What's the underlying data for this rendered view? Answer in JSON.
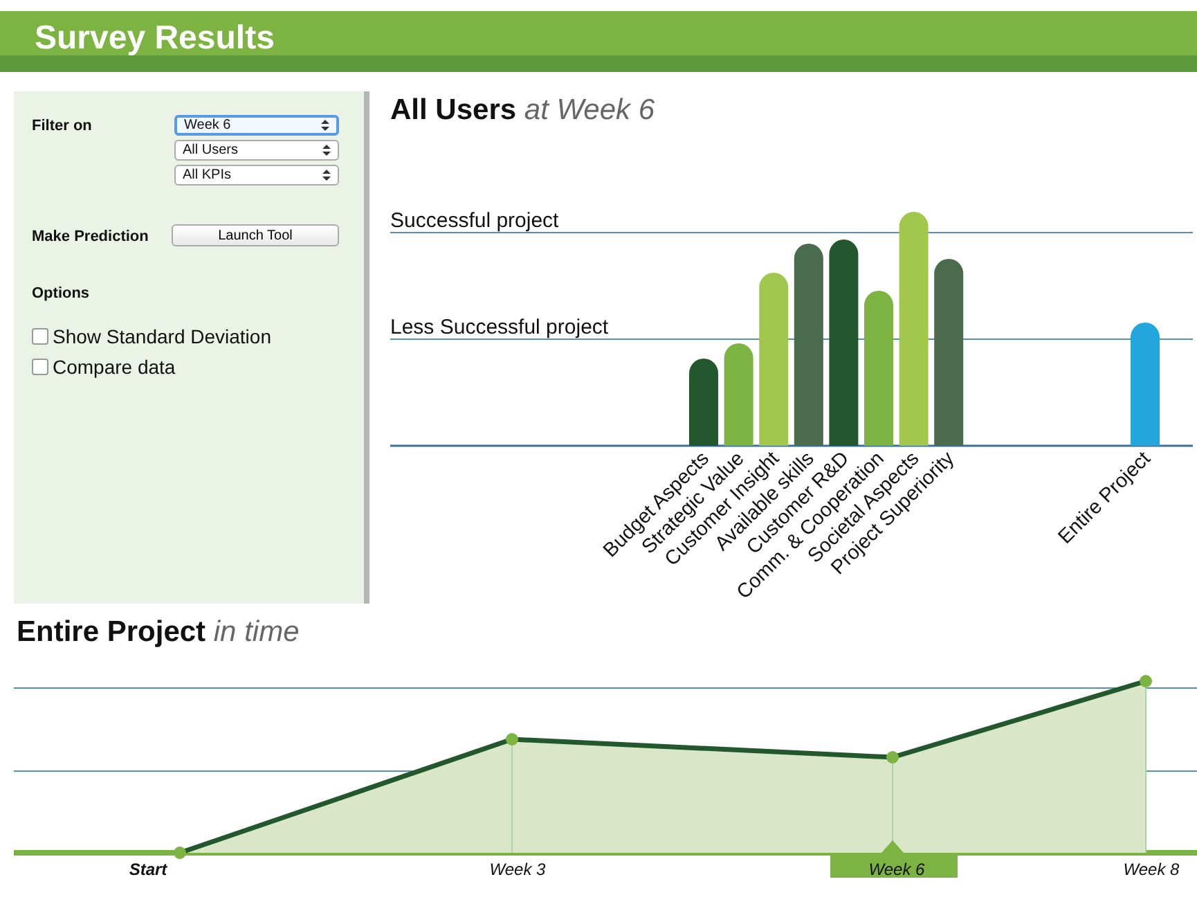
{
  "header": {
    "title": "Survey Results"
  },
  "sidebar": {
    "filter_label": "Filter on",
    "filters": [
      {
        "value": "Week 6",
        "selected": true
      },
      {
        "value": "All Users",
        "selected": false
      },
      {
        "value": "All KPIs",
        "selected": false
      }
    ],
    "prediction_label": "Make Prediction",
    "prediction_button": "Launch Tool",
    "options_label": "Options",
    "options": [
      {
        "label": "Show Standard Deviation",
        "checked": false
      },
      {
        "label": "Compare data",
        "checked": false
      }
    ]
  },
  "kpi_panel": {
    "title": "All Users",
    "subtitle": "at Week 6",
    "reference_lines": [
      "Successful project",
      "Less Successful project"
    ],
    "bars": [
      {
        "label": "Budget Aspects",
        "color": "#23572d"
      },
      {
        "label": "Strategic Value",
        "color": "#7cb342"
      },
      {
        "label": "Customer Insight",
        "color": "#a1c84c"
      },
      {
        "label": "Available skills",
        "color": "#4a6b4c"
      },
      {
        "label": "Customer R&D",
        "color": "#23572d"
      },
      {
        "label": "Comm. & Cooperation",
        "color": "#7cb342"
      },
      {
        "label": "Societal Aspects",
        "color": "#a1c84c"
      },
      {
        "label": "Project Superiority",
        "color": "#4a6b4c"
      }
    ],
    "total_bar": {
      "label": "Entire Project",
      "color": "#22a6dc"
    }
  },
  "timeline": {
    "title": "Entire Project",
    "subtitle": "in time",
    "points": [
      {
        "label": "Start",
        "selected": false
      },
      {
        "label": "Week 3",
        "selected": false
      },
      {
        "label": "Week 6",
        "selected": true
      },
      {
        "label": "Week 8",
        "selected": false
      }
    ]
  }
}
